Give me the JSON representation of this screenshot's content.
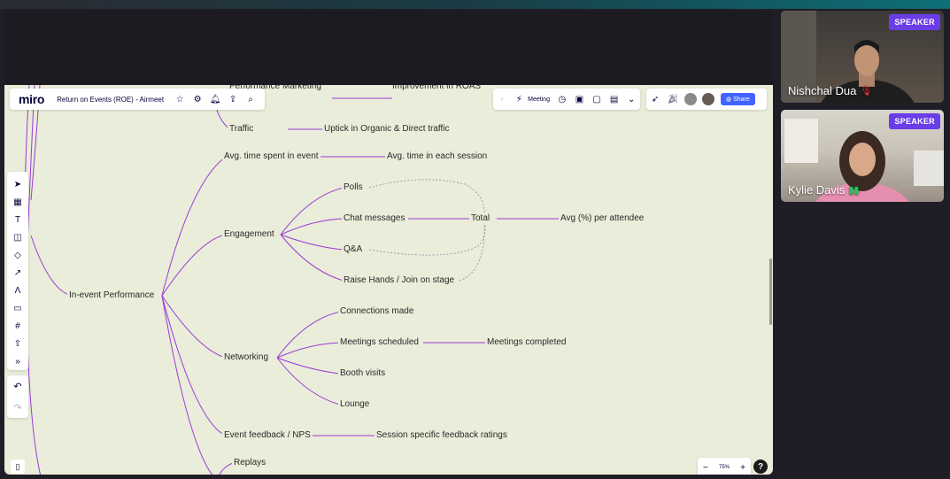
{
  "app": {
    "logo": "miro",
    "board_title": "Return on Events (ROE) - Airmeet",
    "meeting_label": "Meeting",
    "share_label": "Share",
    "zoom_level": "75%",
    "help_label": "?"
  },
  "icons": {
    "star": "star-icon",
    "settings": "gear-icon",
    "bell": "bell-icon",
    "upload": "upload-icon",
    "search": "search-icon",
    "timer": "timer-icon",
    "present": "present-icon"
  },
  "mindmap": {
    "root": "In-event Performance",
    "top_partial": [
      "Performance Marketing",
      "Improvement in ROAS",
      "Traffic",
      "Uptick in Organic & Direct traffic"
    ],
    "avg_time": {
      "label": "Avg. time spent in event",
      "child": "Avg. time in each session"
    },
    "engagement": {
      "label": "Engagement",
      "items": [
        "Polls",
        "Chat messages",
        "Q&A",
        "Raise Hands / Join on stage"
      ],
      "total": "Total",
      "total_child": "Avg (%) per attendee"
    },
    "networking": {
      "label": "Networking",
      "items": [
        "Connections made",
        "Meetings scheduled",
        "Booth visits",
        "Lounge"
      ],
      "meetings_child": "Meetings completed"
    },
    "feedback": {
      "label": "Event feedback / NPS",
      "child": "Session specific feedback ratings"
    },
    "replays": "Replays"
  },
  "participants": [
    {
      "name": "Nishchal Dua",
      "badge": "SPEAKER",
      "mic": "muted"
    },
    {
      "name": "Kylie Davis",
      "badge": "SPEAKER",
      "mic": "speaking"
    }
  ],
  "colors": {
    "edge": "#9b3bd6",
    "canvas": "#e9edd9",
    "share": "#4262ff",
    "speaker_badge": "#6b3de8"
  }
}
